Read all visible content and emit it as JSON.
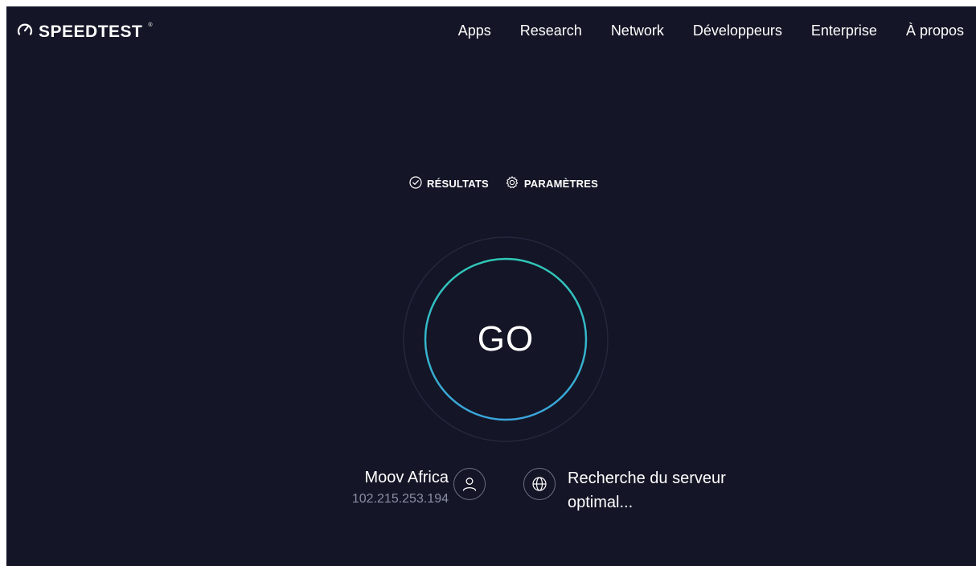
{
  "header": {
    "logo_text": "SPEEDTEST",
    "logo_tm": "®",
    "nav": [
      "Apps",
      "Research",
      "Network",
      "Développeurs",
      "Enterprise",
      "À propos"
    ]
  },
  "tabs": {
    "results": "RÉSULTATS",
    "settings": "PARAMÈTRES"
  },
  "gauge": {
    "go_label": "GO"
  },
  "provider": {
    "name": "Moov Africa",
    "ip": "102.215.253.194"
  },
  "server": {
    "text": "Recherche du serveur optimal..."
  },
  "colors": {
    "background": "#141526",
    "ring_top": "#2fc8b7",
    "ring_bottom": "#3aa4dc",
    "muted": "#8a8fa6"
  },
  "icons": [
    "speedometer-icon",
    "check-circle-icon",
    "gear-icon",
    "user-icon",
    "globe-icon"
  ]
}
